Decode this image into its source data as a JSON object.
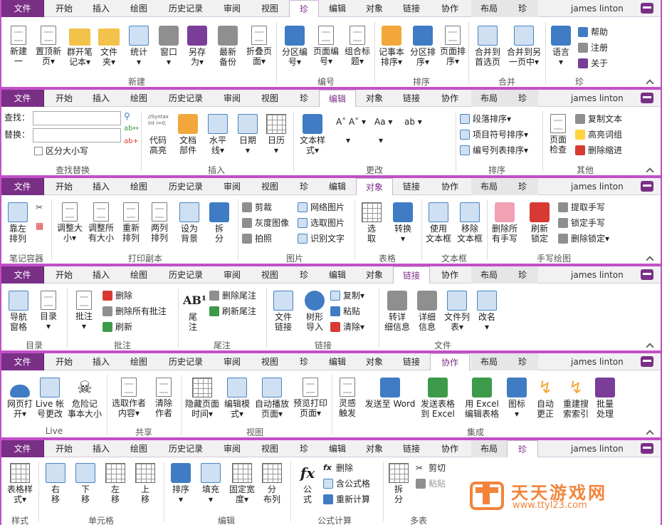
{
  "user": "james linton",
  "colors": {
    "accent": "#7a2f86",
    "panel_border": "#c24fc8",
    "watermark": "#f2843a"
  },
  "tabs": [
    "文件",
    "开始",
    "插入",
    "绘图",
    "历史记录",
    "审阅",
    "视图",
    "珍",
    "编辑",
    "对象",
    "链接",
    "协作",
    "布局",
    "珍"
  ],
  "panel1": {
    "active_tab": "珍",
    "items": [
      "新建\n一",
      "置顶新\n页▾",
      "群开笔\n记本▾",
      "文件\n夹▾",
      "统计\n▾",
      "窗口\n▾",
      "另存\n为▾",
      "最新\n备份",
      "折叠页\n面▾",
      "分区编\n号▾",
      "页面编\n号▾",
      "组合标\n题▾",
      "记事本\n排序▾",
      "分区排\n序▾",
      "页面排\n序▾",
      "合并到\n首选页",
      "合并到另\n一页中▾",
      "语言\n▾"
    ],
    "small": [
      "帮助",
      "注册",
      "关于"
    ],
    "groups": [
      "新建",
      "编号",
      "排序",
      "合并",
      "珍"
    ]
  },
  "panel2": {
    "active_tab": "编辑",
    "find_label": "查找：",
    "replace_label": "替换：",
    "case_label": "区分大小写",
    "items": [
      "代码\n高亮",
      "文档\n部件",
      "水平\n线▾",
      "日期\n▾",
      "日历\n▾",
      "文本样\n式▾",
      "页面\n检查"
    ],
    "mid_small": [
      "A˄ A˅ ▾",
      "Aa ▾",
      "ab ▾",
      "▾",
      "▾"
    ],
    "sort_items": [
      "段落排序▾",
      "项目符号排序▾",
      "编号列表排序▾"
    ],
    "other_small": [
      "复制文本",
      "高亮词组",
      "删除缩进"
    ],
    "groups": [
      "查找替换",
      "插入",
      "更改",
      "排序",
      "其他"
    ],
    "code_sample": "//Syntax\nint i=0;"
  },
  "panel3": {
    "active_tab": "对象",
    "items": [
      "靠左\n排列",
      "调整大\n小▾",
      "调整所\n有大小",
      "重新\n排列",
      "两列\n排列",
      "设为\n背景",
      "拆\n分",
      "选\n取",
      "转换\n▾",
      "使用\n文本框",
      "移除\n文本框",
      "删除所\n有手写",
      "刷新\n锁定"
    ],
    "small": [
      "剪裁",
      "灰度图像",
      "拍照",
      "网络图片",
      "选取图片",
      "识别文字",
      "提取手写",
      "锁定手写",
      "删除锁定▾"
    ],
    "groups": [
      "笔记容器",
      "打印副本",
      "图片",
      "表格",
      "文本框",
      "手写绘图"
    ]
  },
  "panel4": {
    "active_tab": "链接",
    "items": [
      "导航\n窗格",
      "目录\n▾",
      "批注\n▾",
      "尾\n注",
      "文件\n链接",
      "树形\n导入",
      "转详\n细信息",
      "详细\n信息",
      "文件列\n表▾",
      "改名\n▾"
    ],
    "small": [
      "删除",
      "删除所有批注",
      "刷新",
      "删除尾注",
      "刷新尾注",
      "复制▾",
      "粘贴",
      "清除▾"
    ],
    "groups": [
      "目录",
      "批注",
      "尾注",
      "链接",
      "文件"
    ]
  },
  "panel5": {
    "active_tab": "协作",
    "items": [
      "网页打\n开▾",
      "Live 帐\n号更改",
      "危险记\n事本大小",
      "选取作者\n内容▾",
      "清除\n作者",
      "隐藏页面\n时间▾",
      "编辑模\n式▾",
      "自动播放\n页面▾",
      "预览打印\n页面▾",
      "灵感\n触发",
      "发送至 Word",
      "发送表格\n到 Excel",
      "用 Excel\n编辑表格",
      "图标\n▾",
      "自动\n更正",
      "重建搜\n索索引",
      "批量\n处理"
    ],
    "groups": [
      "Live",
      "共享",
      "视图",
      "集成"
    ]
  },
  "panel6": {
    "active_tab": "珍",
    "items": [
      "表格样\n式▾",
      "右\n移",
      "下\n移",
      "左\n移",
      "上\n移",
      "排序\n▾",
      "填充\n▾",
      "固定宽\n度▾",
      "分\n布列",
      "公\n式",
      "拆\n分"
    ],
    "small": [
      "删除",
      "含公式格",
      "重新计算",
      "剪切",
      "粘贴"
    ],
    "groups": [
      "样式",
      "单元格",
      "编辑",
      "公式计算",
      "多表"
    ]
  },
  "watermark": {
    "title": "天天游戏网",
    "url": "www.ttyl23.com"
  }
}
